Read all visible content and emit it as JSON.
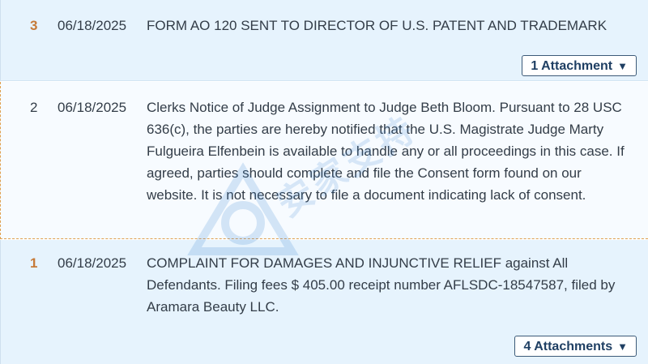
{
  "entries": [
    {
      "number": "3",
      "date": "06/18/2025",
      "text": "FORM AO 120 SENT TO DIRECTOR OF U.S. PATENT AND TRADEMARK",
      "attachments_label": "1 Attachment"
    },
    {
      "number": "2",
      "date": "06/18/2025",
      "text": "Clerks Notice of Judge Assignment to Judge Beth Bloom. Pursuant to 28 USC 636(c), the parties are hereby notified that the U.S. Magistrate Judge Marty Fulgueira Elfenbein is available to handle any or all proceedings in this case. If agreed, parties should complete and file the Consent form found on our website. It is not necessary to file a document indicating lack of consent."
    },
    {
      "number": "1",
      "date": "06/18/2025",
      "text": "COMPLAINT FOR DAMAGES AND INJUNCTIVE RELIEF against All Defendants. Filing fees $ 405.00 receipt number AFLSDC-18547587, filed by Aramara Beauty LLC.",
      "attachments_label": "4 Attachments"
    }
  ],
  "caret_symbol": "▼",
  "watermark": {
    "text": "安家支持"
  },
  "colors": {
    "highlight_bg": "#e6f3fd",
    "number_accent": "#c67a38",
    "button_border": "#3c5a78",
    "dashed_border": "#e0a050"
  }
}
